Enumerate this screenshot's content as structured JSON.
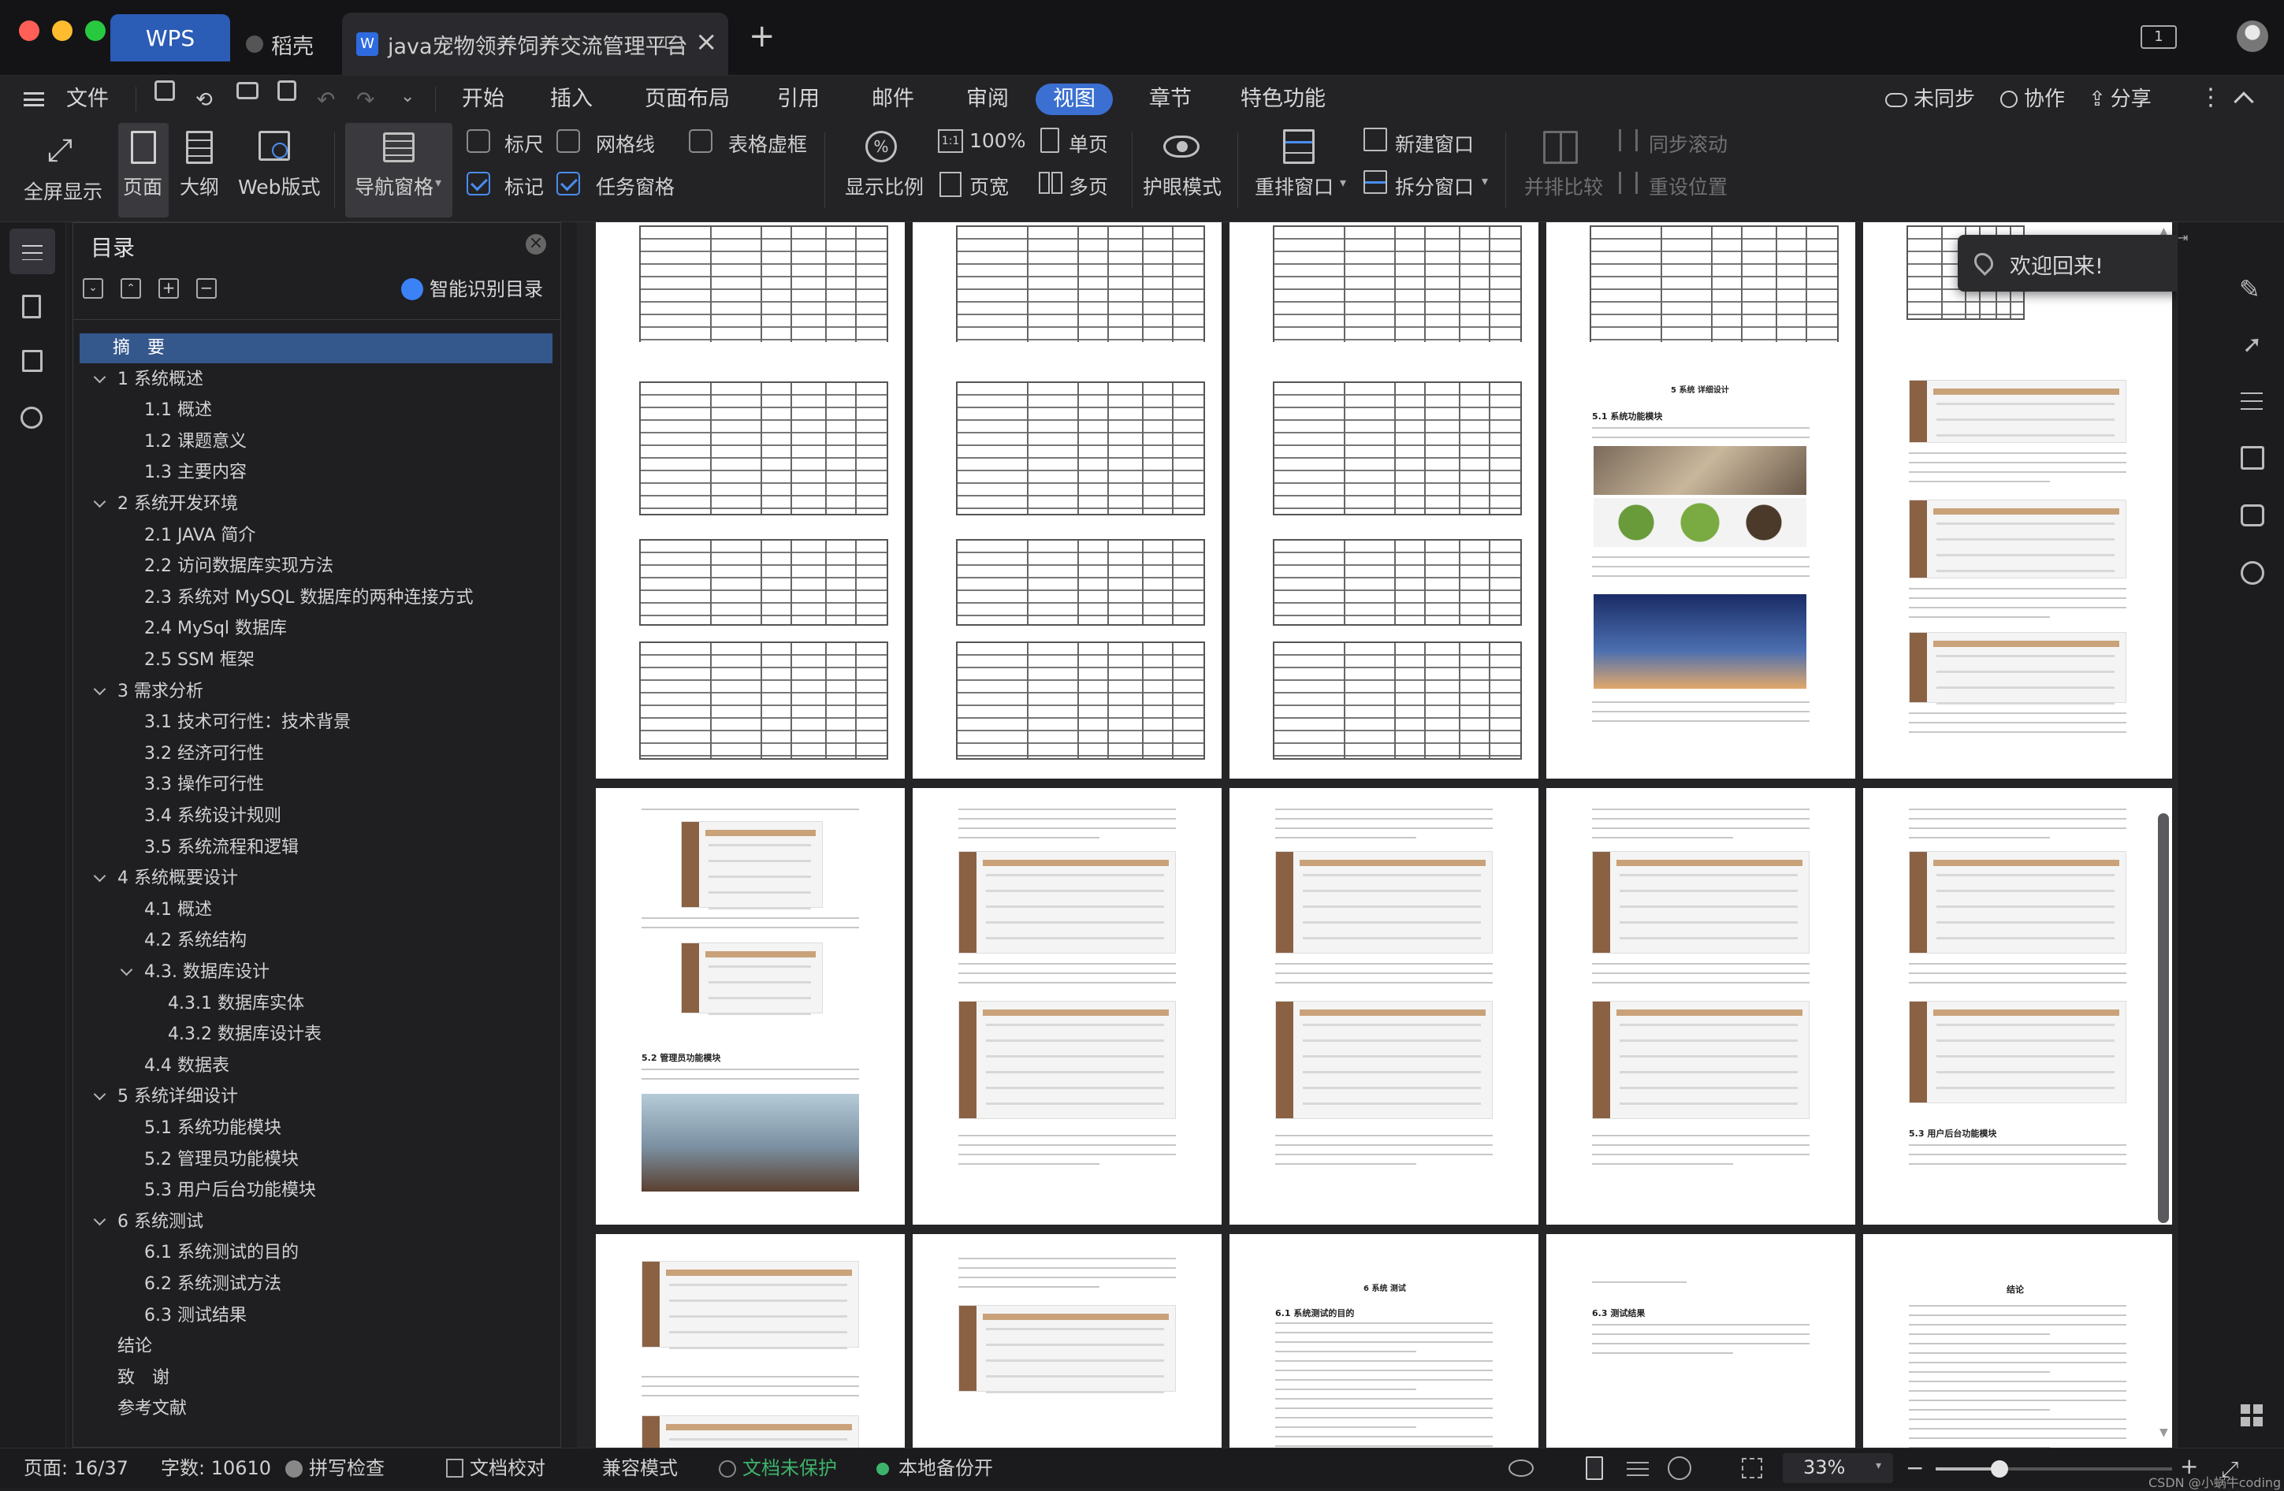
{
  "titlebar": {
    "app_tab": "WPS",
    "tab_daoke": "稻壳",
    "doc_tab": "java宠物领养饲养交流管理平台",
    "layout_badge": "1"
  },
  "menu": {
    "file": "文件",
    "items": [
      "开始",
      "插入",
      "页面布局",
      "引用",
      "邮件",
      "审阅",
      "视图",
      "章节",
      "特色功能"
    ],
    "active": "视图",
    "sync": "未同步",
    "collab": "协作",
    "share": "分享"
  },
  "ribbon": {
    "fullscreen": "全屏显示",
    "page": "页面",
    "outline": "大纲",
    "web": "Web版式",
    "nav_pane": "导航窗格",
    "ruler": "标尺",
    "gridlines": "网格线",
    "table_gridlines": "表格虚框",
    "marks": "标记",
    "task_pane": "任务窗格",
    "zoom_ratio": "显示比例",
    "hundred": "100%",
    "page_width": "页宽",
    "single_page": "单页",
    "multi_page": "多页",
    "eye_mode": "护眼模式",
    "rearrange": "重排窗口",
    "new_window": "新建窗口",
    "split_window": "拆分窗口",
    "side_by_side": "并排比较",
    "sync_scroll": "同步滚动",
    "reset_position": "重设位置",
    "checks": {
      "ruler": false,
      "gridlines": false,
      "table_gridlines": false,
      "marks": true,
      "task_pane": true
    }
  },
  "toc": {
    "title": "目录",
    "smart": "智能识别目录",
    "items": [
      {
        "text": "摘　要",
        "level": 0,
        "selected": true
      },
      {
        "text": "1  系统概述",
        "level": 0,
        "chev": true
      },
      {
        "text": "1.1  概述",
        "level": 1
      },
      {
        "text": "1.2  课题意义",
        "level": 1
      },
      {
        "text": "1.3  主要内容",
        "level": 1
      },
      {
        "text": "2  系统开发环境",
        "level": 0,
        "chev": true
      },
      {
        "text": "2.1 JAVA 简介",
        "level": 1
      },
      {
        "text": "2.2 访问数据库实现方法",
        "level": 1
      },
      {
        "text": "2.3 系统对 MySQL 数据库的两种连接方式",
        "level": 1
      },
      {
        "text": "2.4 MySql 数据库",
        "level": 1
      },
      {
        "text": "2.5 SSM 框架",
        "level": 1
      },
      {
        "text": "3  需求分析",
        "level": 0,
        "chev": true
      },
      {
        "text": "3.1 技术可行性：技术背景",
        "level": 1
      },
      {
        "text": "3.2 经济可行性",
        "level": 1
      },
      {
        "text": "3.3 操作可行性",
        "level": 1
      },
      {
        "text": "3.4 系统设计规则",
        "level": 1
      },
      {
        "text": "3.5 系统流程和逻辑",
        "level": 1
      },
      {
        "text": "4 系统概要设计",
        "level": 0,
        "chev": true
      },
      {
        "text": "4.1  概述",
        "level": 1
      },
      {
        "text": "4.2  系统结构",
        "level": 1
      },
      {
        "text": "4.3.  数据库设计",
        "level": 1,
        "chev": true
      },
      {
        "text": "4.3.1  数据库实体",
        "level": 2
      },
      {
        "text": "4.3.2  数据库设计表",
        "level": 2
      },
      {
        "text": "4.4  数据表",
        "level": 1
      },
      {
        "text": "5   系统详细设计",
        "level": 0,
        "chev": true
      },
      {
        "text": "5.1 系统功能模块",
        "level": 1
      },
      {
        "text": "5.2 管理员功能模块",
        "level": 1
      },
      {
        "text": "5.3 用户后台功能模块",
        "level": 1
      },
      {
        "text": "6  系统测试",
        "level": 0,
        "chev": true
      },
      {
        "text": "6.1 系统测试的目的",
        "level": 1
      },
      {
        "text": "6.2 系统测试方法",
        "level": 1
      },
      {
        "text": "6.3  测试结果",
        "level": 1
      },
      {
        "text": "结论",
        "level": -1
      },
      {
        "text": "致　谢",
        "level": -1
      },
      {
        "text": "参考文献",
        "level": -1
      }
    ]
  },
  "pages": {
    "h_5": "5  系统 详细设计",
    "h_51": "5.1 系统功能模块",
    "h_52": "5.2 管理员功能模块",
    "h_53": "5.3 用户后台功能模块",
    "h_6": "6  系统 测试",
    "h_61": "6.1 系统测试的目的",
    "h_63": "6.3 测试结果",
    "h_conc": "结论"
  },
  "welcome": "欢迎回来!",
  "status": {
    "page": "页面: 16/37",
    "words": "字数: 10610",
    "spell": "拼写检查",
    "proof": "文档校对",
    "compat": "兼容模式",
    "unprotected": "文档未保护",
    "backup": "本地备份开",
    "zoom": "33%",
    "zoom_level": 0.33,
    "watermark": "CSDN @小蜗牛coding"
  },
  "colors": {
    "accent": "#2b5cb6",
    "active_tab": "#3b6fd1",
    "toc_selected": "#34578c",
    "brown": "#8b6144",
    "green_ok": "#3db36b"
  }
}
